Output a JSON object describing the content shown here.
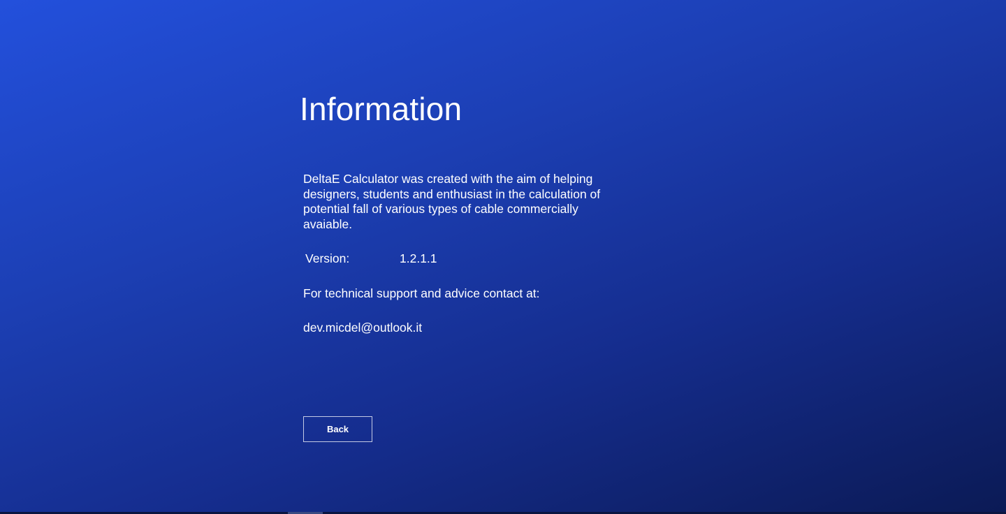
{
  "page": {
    "title": "Information",
    "description": "DeltaE Calculator was created with the aim of helping designers, students and enthusiast in the calculation of potential fall of various types of cable commercially avaiable.",
    "version_label": "Version:",
    "version_value": "1.2.1.1",
    "support_text": "For technical support and advice contact at:",
    "email": "dev.micdel@outlook.it",
    "back_label": "Back"
  },
  "colors": {
    "gradient_start": "#2350dc",
    "gradient_end": "#0b1a55",
    "text": "#ffffff"
  }
}
